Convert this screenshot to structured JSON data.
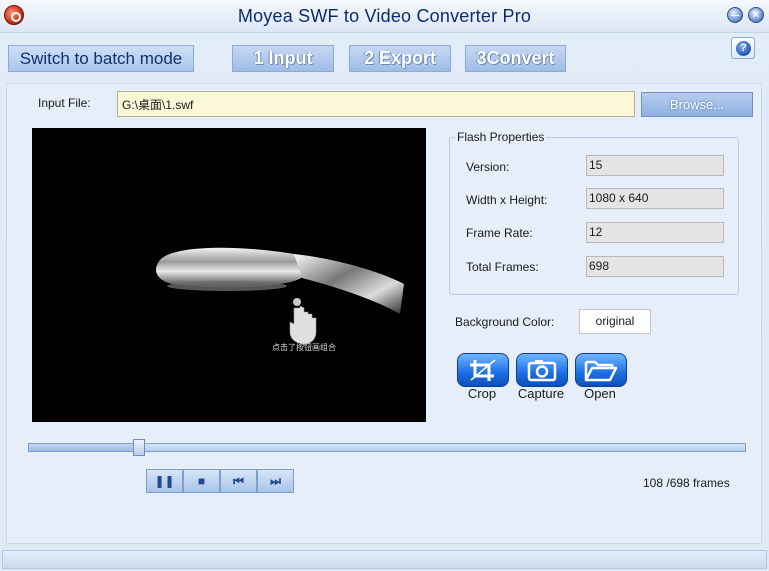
{
  "window": {
    "title": "Moyea SWF to Video Converter Pro",
    "minimize_glyph": "—",
    "close_glyph": "✕",
    "help_glyph": "?"
  },
  "toolbar": {
    "batch_label": "Switch to batch mode",
    "steps": [
      {
        "label": "1 Input"
      },
      {
        "label": "2 Export"
      },
      {
        "label": "3Convert"
      }
    ]
  },
  "input": {
    "label": "Input File:",
    "value": "G:\\桌面\\1.swf",
    "browse_label": "Browse..."
  },
  "preview": {
    "caption": "点击了按钮画组合"
  },
  "flash_properties": {
    "legend": "Flash Properties",
    "rows": [
      {
        "label": "Version:",
        "value": "15"
      },
      {
        "label": "Width x Height:",
        "value": "1080 x 640"
      },
      {
        "label": "Frame Rate:",
        "value": "12"
      },
      {
        "label": "Total Frames:",
        "value": "698"
      }
    ]
  },
  "background": {
    "label": "Background Color:",
    "value": "original"
  },
  "tools": [
    {
      "label": "Crop",
      "icon": "crop-icon"
    },
    {
      "label": "Capture",
      "icon": "camera-icon"
    },
    {
      "label": "Open",
      "icon": "folder-open-icon"
    }
  ],
  "playback": {
    "current_frame": 108,
    "total_frames": 698,
    "frames_text": "108 /698 frames",
    "progress_fraction": 0.155,
    "buttons": [
      {
        "name": "pause-button",
        "glyph": "❚❚"
      },
      {
        "name": "stop-button",
        "glyph": "■"
      },
      {
        "name": "previous-button",
        "glyph": "⏮"
      },
      {
        "name": "next-button",
        "glyph": "⏭"
      }
    ]
  },
  "colors": {
    "accent": "#1c6de6",
    "title_text": "#0d2c6b",
    "input_bg": "#fbf8d7"
  }
}
